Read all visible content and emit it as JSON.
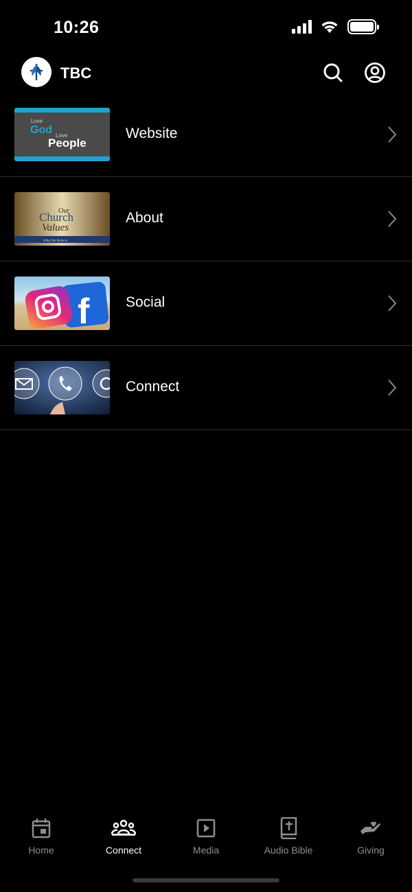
{
  "status_bar": {
    "time": "10:26"
  },
  "header": {
    "title": "TBC",
    "logo_icon": "church-logo-icon",
    "search_icon": "search-icon",
    "account_icon": "account-icon"
  },
  "list": {
    "items": [
      {
        "label": "Website",
        "thumb": {
          "line1": "Love",
          "line2": "God",
          "line3": "Love",
          "line4": "People"
        }
      },
      {
        "label": "About",
        "thumb": {
          "line1": "Our",
          "line2": "Church",
          "line3": "Values",
          "line4": "What We Believe"
        }
      },
      {
        "label": "Social"
      },
      {
        "label": "Connect"
      }
    ]
  },
  "tabs": [
    {
      "label": "Home",
      "icon": "calendar-icon",
      "active": false
    },
    {
      "label": "Connect",
      "icon": "people-icon",
      "active": true
    },
    {
      "label": "Media",
      "icon": "play-icon",
      "active": false
    },
    {
      "label": "Audio Bible",
      "icon": "bible-icon",
      "active": false
    },
    {
      "label": "Giving",
      "icon": "giving-hand-icon",
      "active": false
    }
  ],
  "colors": {
    "background": "#000000",
    "active_tab": "#ffffff",
    "inactive_tab": "#8e8e8e",
    "divider": "#2e2e2e"
  }
}
